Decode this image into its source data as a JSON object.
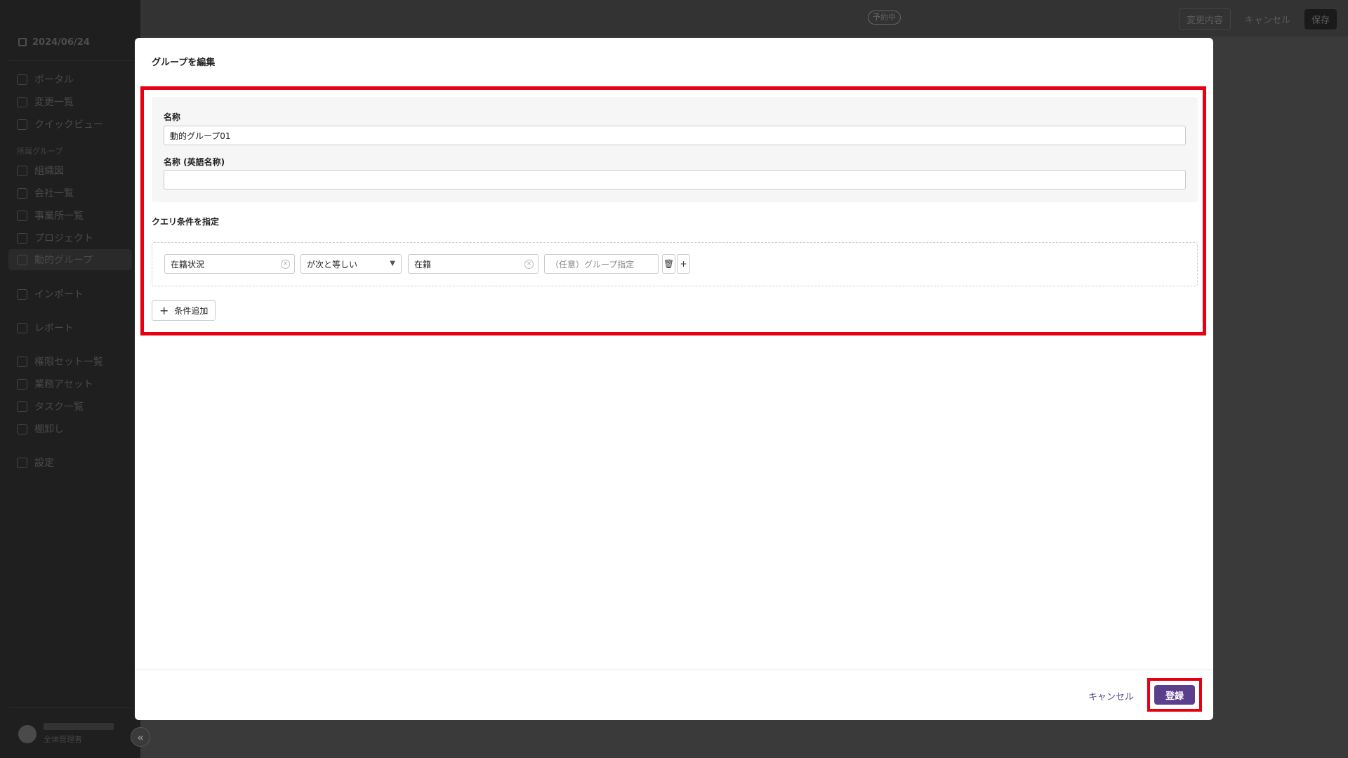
{
  "app": {
    "sidebar": {
      "date": "2024/06/24",
      "items_top": [
        "ポータル",
        "変更一覧",
        "クイックビュー"
      ],
      "section_label": "所属グループ",
      "items_group": [
        "組織図",
        "会社一覧",
        "事業所一覧",
        "プロジェクト",
        "動的グループ"
      ],
      "items_bottom": [
        "インポート",
        "レポート",
        "権限セット一覧",
        "業務アセット",
        "タスク一覧",
        "棚卸し",
        "設定"
      ],
      "user_role": "全体管理者"
    },
    "topbar": {
      "status": "予約中",
      "changes": "変更内容",
      "cancel": "キャンセル",
      "save": "保存"
    }
  },
  "modal": {
    "title": "グループを編集",
    "name_label": "名称",
    "name_value": "動的グループ01",
    "name_en_label": "名称 (英語名称)",
    "name_en_value": "",
    "query_title": "クエリ条件を指定",
    "condition": {
      "field": "在籍状況",
      "operator": "が次と等しい",
      "value": "在籍",
      "group_placeholder": "（任意）グループ指定"
    },
    "add_condition": "条件追加",
    "cancel": "キャンセル",
    "submit": "登録"
  },
  "colors": {
    "highlight": "#e60012",
    "primary": "#5b3f8c"
  }
}
